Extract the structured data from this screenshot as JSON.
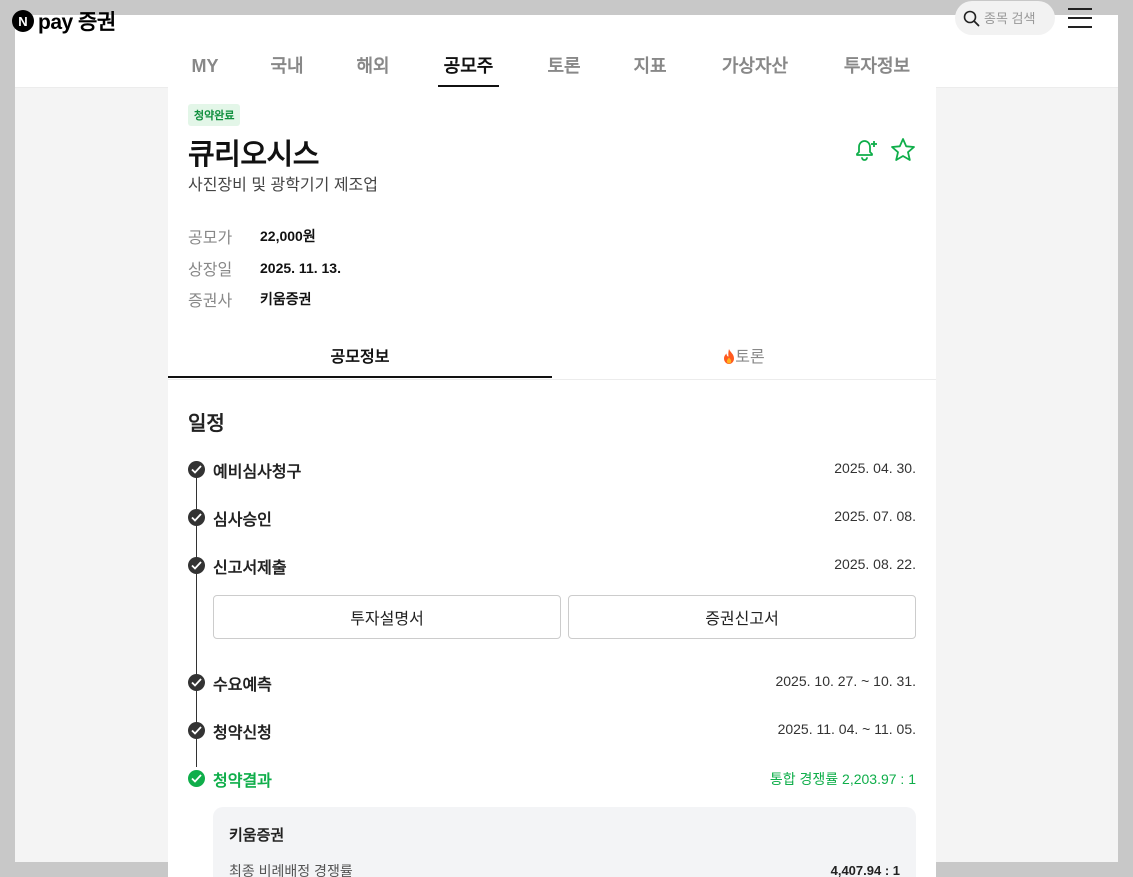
{
  "brand": {
    "logo_letter": "N",
    "name": "pay 증권"
  },
  "search": {
    "placeholder": "종목 검색"
  },
  "nav": {
    "tabs": [
      {
        "label": "MY"
      },
      {
        "label": "국내"
      },
      {
        "label": "해외"
      },
      {
        "label": "공모주",
        "active": true
      },
      {
        "label": "토론"
      },
      {
        "label": "지표"
      },
      {
        "label": "가상자산"
      },
      {
        "label": "투자정보"
      }
    ]
  },
  "ipo": {
    "status_badge": "청약완료",
    "name": "큐리오시스",
    "industry": "사진장비 및 광학기기 제조업",
    "details": [
      {
        "label": "공모가",
        "value": "22,000원"
      },
      {
        "label": "상장일",
        "value": "2025. 11. 13."
      },
      {
        "label": "증권사",
        "value": "키움증권"
      }
    ]
  },
  "sub_tabs": [
    {
      "label": "공모정보",
      "active": true
    },
    {
      "label": "토론",
      "icon": "fire-icon"
    }
  ],
  "schedule": {
    "title": "일정",
    "steps": [
      {
        "name": "예비심사청구",
        "date": "2025. 04. 30."
      },
      {
        "name": "심사승인",
        "date": "2025. 07. 08."
      },
      {
        "name": "신고서제출",
        "date": "2025. 08. 22."
      },
      {
        "name": "수요예측",
        "date": "2025. 10. 27. ~ 10. 31."
      },
      {
        "name": "청약신청",
        "date": "2025. 11. 04. ~ 11. 05."
      },
      {
        "name": "청약결과",
        "date": "통합 경쟁률 2,203.97 : 1",
        "highlight": true
      }
    ],
    "doc_buttons": [
      "투자설명서",
      "증권신고서"
    ],
    "result": {
      "broker": "키움증권",
      "label": "최종 비례배정 경쟁률",
      "value": "4,407.94 : 1"
    }
  },
  "colors": {
    "accent_green": "#0fae4a",
    "badge_bg": "#e3f6e8",
    "dark": "#222222"
  }
}
